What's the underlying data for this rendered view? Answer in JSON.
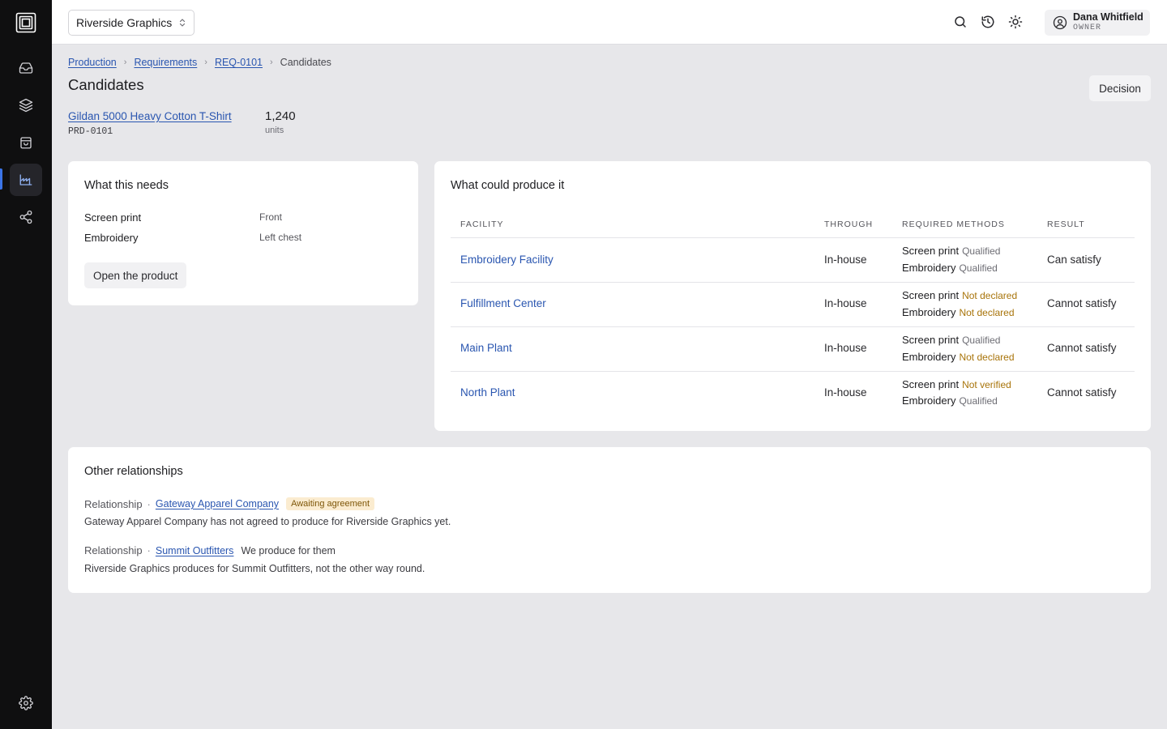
{
  "org": {
    "name": "Riverside Graphics"
  },
  "nav": {
    "items": [
      {
        "icon": "inbox-icon"
      },
      {
        "icon": "layers-icon"
      },
      {
        "icon": "shopping-bag-icon"
      },
      {
        "icon": "factory-icon",
        "active": true
      },
      {
        "icon": "share-icon"
      }
    ],
    "settings_icon": "gear-icon"
  },
  "topbar": {
    "icons": [
      "search-icon",
      "history-icon",
      "sun-icon"
    ]
  },
  "user": {
    "name": "Dana Whitfield",
    "role": "OWNER"
  },
  "breadcrumb": {
    "items": [
      "Production",
      "Requirements",
      "REQ-0101"
    ],
    "current": "Candidates"
  },
  "page": {
    "title": "Candidates",
    "decision_label": "Decision"
  },
  "product": {
    "name": "Gildan 5000 Heavy Cotton T-Shirt",
    "code": "PRD-0101",
    "quantity": "1,240",
    "unit": "units"
  },
  "needs": {
    "title": "What this needs",
    "items": [
      {
        "method": "Screen print",
        "location": "Front"
      },
      {
        "method": "Embroidery",
        "location": "Left chest"
      }
    ],
    "open_label": "Open the product"
  },
  "produce": {
    "title": "What could produce it",
    "headers": [
      "FACILITY",
      "THROUGH",
      "REQUIRED METHODS",
      "RESULT"
    ],
    "rows": [
      {
        "facility": "Embroidery Facility",
        "through": "In-house",
        "methods": [
          {
            "name": "Screen print",
            "status": "Qualified"
          },
          {
            "name": "Embroidery",
            "status": "Qualified"
          }
        ],
        "result": "Can satisfy"
      },
      {
        "facility": "Fulfillment Center",
        "through": "In-house",
        "methods": [
          {
            "name": "Screen print",
            "status": "Not declared"
          },
          {
            "name": "Embroidery",
            "status": "Not declared"
          }
        ],
        "result": "Cannot satisfy"
      },
      {
        "facility": "Main Plant",
        "through": "In-house",
        "methods": [
          {
            "name": "Screen print",
            "status": "Qualified"
          },
          {
            "name": "Embroidery",
            "status": "Not declared"
          }
        ],
        "result": "Cannot satisfy"
      },
      {
        "facility": "North Plant",
        "through": "In-house",
        "methods": [
          {
            "name": "Screen print",
            "status": "Not verified"
          },
          {
            "name": "Embroidery",
            "status": "Qualified"
          }
        ],
        "result": "Cannot satisfy"
      }
    ]
  },
  "other": {
    "title": "Other relationships",
    "relationships": [
      {
        "label": "Relationship",
        "dot": "·",
        "partner": "Gateway Apparel Company",
        "badge": "Awaiting agreement",
        "description": "Gateway Apparel Company has not agreed to produce for Riverside Graphics yet."
      },
      {
        "label": "Relationship",
        "dot": "·",
        "partner": "Summit Outfitters",
        "note": "We produce for them",
        "description": "Riverside Graphics produces for Summit Outfitters, not the other way round."
      }
    ]
  },
  "colors": {
    "link": "#2a56b0",
    "warn": "#a8740a",
    "sidebar": "#0f0f10",
    "active_indicator": "#3b74e6",
    "badge_bg": "#fbecd0"
  }
}
